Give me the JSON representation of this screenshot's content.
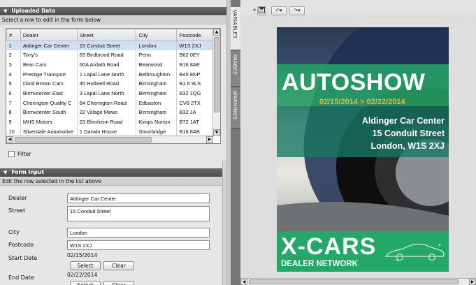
{
  "uploaded_panel": {
    "title": "Uploaded Data",
    "subtitle": "Select a row to edit in the form below",
    "columns": [
      "#",
      "Dealer",
      "Street",
      "City",
      "Postcode"
    ],
    "rows": [
      [
        "1",
        "Aldinger Car Center",
        "15 Conduit Street",
        "London",
        "W1S 2XJ"
      ],
      [
        "2",
        "Tony's",
        "65 Birdbrood Road",
        "Penn",
        "B62 0EY"
      ],
      [
        "3",
        "Bear Cars",
        "60A Ardath Road",
        "Bearwood",
        "B16 8AE"
      ],
      [
        "4",
        "Prestige Transport",
        "1 Lapal Lane North",
        "Belbroughton",
        "B45 8NP"
      ],
      [
        "5",
        "Divid Brown Cars",
        "45 Hollwell Road",
        "Birmingham",
        "B1 6 9LS"
      ],
      [
        "6",
        "Birmvcenter East",
        "3 Lapal Lane North",
        "Birmingham",
        "B32 1QG"
      ],
      [
        "7",
        "Cherington Quality C",
        "64 Cherington Road",
        "Edbaston",
        "CV8 2TX"
      ],
      [
        "8",
        "Birmvcenter South",
        "22 Village Mews",
        "Birmingham",
        "B32 JA"
      ],
      [
        "9",
        "MHS Motors",
        "23 Blenheim Road",
        "Kinqis Norton",
        "B72 1AT"
      ],
      [
        "10",
        "Silverdale Automotive",
        "1 Darwin House",
        "Stourbridge",
        "B16 8AB"
      ]
    ],
    "filter_label": "Filter"
  },
  "form_panel": {
    "title": "Form Input",
    "subtitle": "Edit the row selected in the list above",
    "fields": {
      "dealer": {
        "label": "Dealer",
        "value": "Aldinger Car Center"
      },
      "street": {
        "label": "Street",
        "value": "15 Conduit Street"
      },
      "city": {
        "label": "City",
        "value": "London"
      },
      "postcode": {
        "label": "Postcode",
        "value": "W1S 2XJ"
      },
      "start_date": {
        "label": "Start Date",
        "value": "02/15/2014"
      },
      "end_date": {
        "label": "End Date",
        "value": "02/22/2014"
      }
    },
    "select_label": "Select",
    "clear_label": "Clear"
  },
  "side_tabs": [
    "VARIABLES",
    "IMAGES",
    "WARNINGS"
  ],
  "toolbar": {
    "marker": "*"
  },
  "poster": {
    "headline": "AUTOSHOW",
    "dates": "02/15/2014 > 02/22/2014",
    "dealer": "Aldinger Car Center",
    "street": "15 Conduit Street",
    "city_line": "London, W1S 2XJ",
    "brand": "X-CARS",
    "network": "DEALER NETWORK",
    "colors": {
      "green": "#23a868",
      "date_orange": "#f0b040"
    }
  }
}
